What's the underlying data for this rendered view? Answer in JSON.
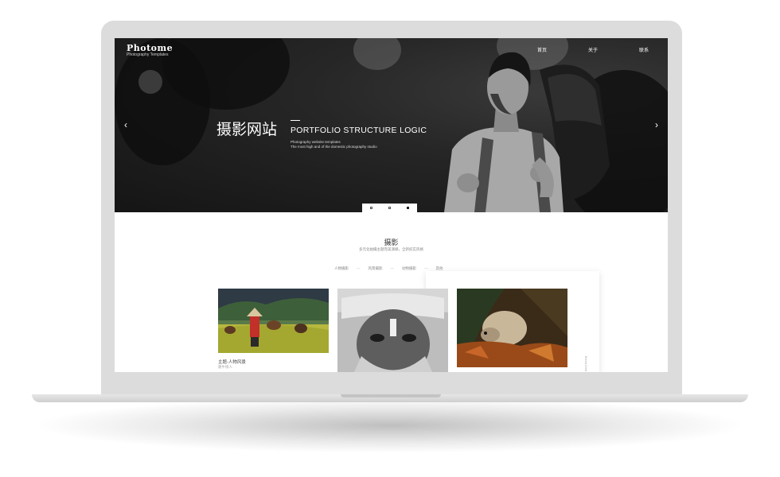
{
  "header": {
    "logo": "Photome",
    "tagline": "Photography Templates",
    "nav": [
      "首页",
      "关于",
      "联系"
    ]
  },
  "hero": {
    "title_cn": "摄影网站",
    "subtitle": "PORTFOLIO STRUCTURE LOGIC",
    "desc_line1": "Photography website templates",
    "desc_line2": "The most high and of the domestic photography studio",
    "prev": "‹",
    "next": "›"
  },
  "section": {
    "title": "摄影",
    "subtitle": "多元化拍摄主题完美演绎，全新纪实风格",
    "filters": [
      "人物摄影",
      "风景摄影",
      "动物摄影",
      "其他"
    ],
    "separator": "—"
  },
  "gallery": {
    "first_caption": "主题-人物风景",
    "first_subcaption": "路牛情人",
    "side_text": "Bolivia Dred"
  },
  "colors": {
    "lid": "#dcdcdc",
    "hero_dark": "#262626",
    "accent": "#ffffff"
  }
}
